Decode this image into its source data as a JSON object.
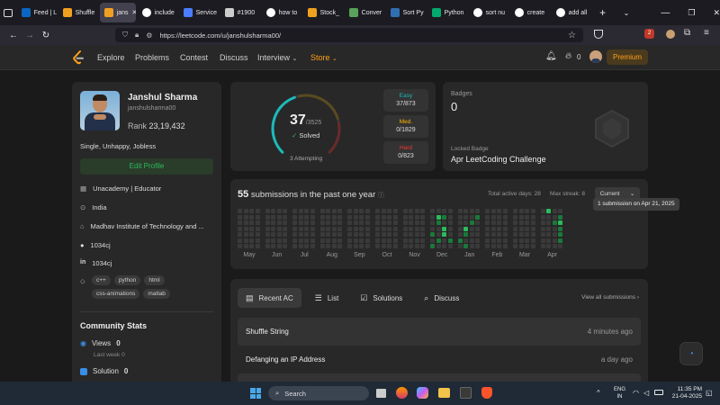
{
  "browser": {
    "tabs": [
      {
        "label": "Feed | L",
        "icon": "linkedin-icon",
        "color": "#0a66c2"
      },
      {
        "label": "Shuffle",
        "icon": "leetcode-icon",
        "color": "#f0a020"
      },
      {
        "label": "jans",
        "icon": "leetcode-icon",
        "color": "#f0a020",
        "active": true
      },
      {
        "label": "include",
        "icon": "github-icon",
        "color": "#ffffff"
      },
      {
        "label": "Service",
        "icon": "doc-icon",
        "color": "#4a7dff"
      },
      {
        "label": "#1900",
        "icon": "hash-icon",
        "color": "#cccccc"
      },
      {
        "label": "how to",
        "icon": "google-icon",
        "color": "#ffffff"
      },
      {
        "label": "Stock_",
        "icon": "stock-icon",
        "color": "#f0a020"
      },
      {
        "label": "Conver",
        "icon": "convert-icon",
        "color": "#5aa05a"
      },
      {
        "label": "Sort Py",
        "icon": "py-icon",
        "color": "#2f6fb0"
      },
      {
        "label": "Python",
        "icon": "w3-icon",
        "color": "#04aa6d"
      },
      {
        "label": "sort nu",
        "icon": "google-icon",
        "color": "#ffffff"
      },
      {
        "label": "create",
        "icon": "google-icon",
        "color": "#ffffff"
      },
      {
        "label": "add all",
        "icon": "google-icon",
        "color": "#ffffff"
      }
    ],
    "close_tab": "✕",
    "new_tab": "+",
    "url": "https://leetcode.com/u/janshulsharma00/",
    "extension_badge": "2"
  },
  "nav": {
    "explore": "Explore",
    "problems": "Problems",
    "contest": "Contest",
    "discuss": "Discuss",
    "interview": "Interview",
    "store": "Store",
    "streak": "0",
    "premium": "Premium"
  },
  "profile": {
    "name": "Janshul Sharma",
    "username": "janshulsharma00",
    "rank_label": "Rank",
    "rank": "23,19,432",
    "bio": "Single, Unhappy, Jobless",
    "edit": "Edit Profile",
    "company": "Unacademy | Educator",
    "location": "India",
    "school": "Madhav Institute of Technology and ...",
    "github": "1034cj",
    "linkedin": "1034cj",
    "skills": [
      "c++",
      "python",
      "html",
      "css-animations",
      "matlab"
    ]
  },
  "community": {
    "title": "Community Stats",
    "views_label": "Views",
    "views": "0",
    "views_sub": "Last week 0",
    "solution_label": "Solution",
    "solution": "0"
  },
  "solved": {
    "count": "37",
    "total": "/3525",
    "label": "Solved",
    "attempting": "3 Attempting",
    "easy_label": "Easy",
    "easy": "37/873",
    "med_label": "Med.",
    "med": "0/1829",
    "hard_label": "Hard",
    "hard": "0/823",
    "colors": {
      "easy": "#1cbaba",
      "med": "#ffb700",
      "hard": "#f63737"
    }
  },
  "badges": {
    "label": "Badges",
    "count": "0",
    "locked_label": "Locked Badge",
    "locked_name": "Apr LeetCoding Challenge"
  },
  "heatmap": {
    "count": "55",
    "title_rest": "submissions in the past one year",
    "active_days": "Total active days: 28",
    "max_streak": "Max streak: 8",
    "current": "Current",
    "tooltip": "1 submission on Apr 21, 2025",
    "months": [
      "May",
      "Jun",
      "Jul",
      "Aug",
      "Sep",
      "Oct",
      "Nov",
      "Dec",
      "Jan",
      "Feb",
      "Mar",
      "Apr"
    ]
  },
  "recent": {
    "tabs": [
      {
        "label": "Recent AC",
        "icon": "recent-icon"
      },
      {
        "label": "List",
        "icon": "list-icon"
      },
      {
        "label": "Solutions",
        "icon": "solutions-icon"
      },
      {
        "label": "Discuss",
        "icon": "discuss-icon"
      }
    ],
    "view_all": "View all submissions",
    "items": [
      {
        "title": "Shuffle String",
        "time": "4 minutes ago"
      },
      {
        "title": "Defanging an IP Address",
        "time": "a day ago"
      }
    ]
  },
  "taskbar": {
    "search": "Search",
    "lang1": "ENG",
    "lang2": "IN",
    "time": "11:35 PM",
    "date": "21-04-2025"
  }
}
